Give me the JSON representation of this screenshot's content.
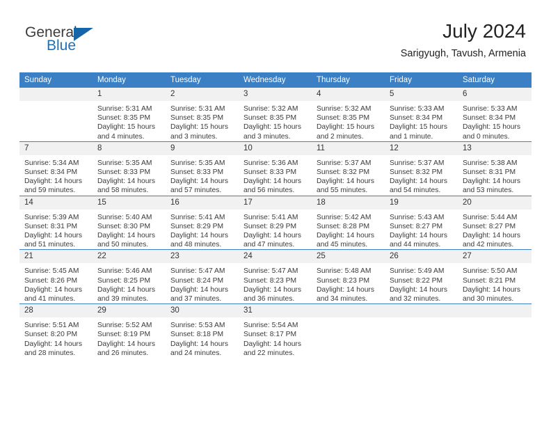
{
  "brand": {
    "name_part1": "General",
    "name_part2": "Blue",
    "logo_icon": "triangle-icon",
    "accent_color": "#1565a8"
  },
  "header": {
    "month_title": "July 2024",
    "location": "Sarigyugh, Tavush, Armenia"
  },
  "calendar": {
    "header_color": "#3b7fc4",
    "daynum_bg": "#f1f1f1",
    "weekday_headers": [
      "Sunday",
      "Monday",
      "Tuesday",
      "Wednesday",
      "Thursday",
      "Friday",
      "Saturday"
    ],
    "weeks": [
      [
        {
          "day": "",
          "lines": []
        },
        {
          "day": "1",
          "lines": [
            "Sunrise: 5:31 AM",
            "Sunset: 8:35 PM",
            "Daylight: 15 hours",
            "and 4 minutes."
          ]
        },
        {
          "day": "2",
          "lines": [
            "Sunrise: 5:31 AM",
            "Sunset: 8:35 PM",
            "Daylight: 15 hours",
            "and 3 minutes."
          ]
        },
        {
          "day": "3",
          "lines": [
            "Sunrise: 5:32 AM",
            "Sunset: 8:35 PM",
            "Daylight: 15 hours",
            "and 3 minutes."
          ]
        },
        {
          "day": "4",
          "lines": [
            "Sunrise: 5:32 AM",
            "Sunset: 8:35 PM",
            "Daylight: 15 hours",
            "and 2 minutes."
          ]
        },
        {
          "day": "5",
          "lines": [
            "Sunrise: 5:33 AM",
            "Sunset: 8:34 PM",
            "Daylight: 15 hours",
            "and 1 minute."
          ]
        },
        {
          "day": "6",
          "lines": [
            "Sunrise: 5:33 AM",
            "Sunset: 8:34 PM",
            "Daylight: 15 hours",
            "and 0 minutes."
          ]
        }
      ],
      [
        {
          "day": "7",
          "lines": [
            "Sunrise: 5:34 AM",
            "Sunset: 8:34 PM",
            "Daylight: 14 hours",
            "and 59 minutes."
          ]
        },
        {
          "day": "8",
          "lines": [
            "Sunrise: 5:35 AM",
            "Sunset: 8:33 PM",
            "Daylight: 14 hours",
            "and 58 minutes."
          ]
        },
        {
          "day": "9",
          "lines": [
            "Sunrise: 5:35 AM",
            "Sunset: 8:33 PM",
            "Daylight: 14 hours",
            "and 57 minutes."
          ]
        },
        {
          "day": "10",
          "lines": [
            "Sunrise: 5:36 AM",
            "Sunset: 8:33 PM",
            "Daylight: 14 hours",
            "and 56 minutes."
          ]
        },
        {
          "day": "11",
          "lines": [
            "Sunrise: 5:37 AM",
            "Sunset: 8:32 PM",
            "Daylight: 14 hours",
            "and 55 minutes."
          ]
        },
        {
          "day": "12",
          "lines": [
            "Sunrise: 5:37 AM",
            "Sunset: 8:32 PM",
            "Daylight: 14 hours",
            "and 54 minutes."
          ]
        },
        {
          "day": "13",
          "lines": [
            "Sunrise: 5:38 AM",
            "Sunset: 8:31 PM",
            "Daylight: 14 hours",
            "and 53 minutes."
          ]
        }
      ],
      [
        {
          "day": "14",
          "lines": [
            "Sunrise: 5:39 AM",
            "Sunset: 8:31 PM",
            "Daylight: 14 hours",
            "and 51 minutes."
          ]
        },
        {
          "day": "15",
          "lines": [
            "Sunrise: 5:40 AM",
            "Sunset: 8:30 PM",
            "Daylight: 14 hours",
            "and 50 minutes."
          ]
        },
        {
          "day": "16",
          "lines": [
            "Sunrise: 5:41 AM",
            "Sunset: 8:29 PM",
            "Daylight: 14 hours",
            "and 48 minutes."
          ]
        },
        {
          "day": "17",
          "lines": [
            "Sunrise: 5:41 AM",
            "Sunset: 8:29 PM",
            "Daylight: 14 hours",
            "and 47 minutes."
          ]
        },
        {
          "day": "18",
          "lines": [
            "Sunrise: 5:42 AM",
            "Sunset: 8:28 PM",
            "Daylight: 14 hours",
            "and 45 minutes."
          ]
        },
        {
          "day": "19",
          "lines": [
            "Sunrise: 5:43 AM",
            "Sunset: 8:27 PM",
            "Daylight: 14 hours",
            "and 44 minutes."
          ]
        },
        {
          "day": "20",
          "lines": [
            "Sunrise: 5:44 AM",
            "Sunset: 8:27 PM",
            "Daylight: 14 hours",
            "and 42 minutes."
          ]
        }
      ],
      [
        {
          "day": "21",
          "lines": [
            "Sunrise: 5:45 AM",
            "Sunset: 8:26 PM",
            "Daylight: 14 hours",
            "and 41 minutes."
          ]
        },
        {
          "day": "22",
          "lines": [
            "Sunrise: 5:46 AM",
            "Sunset: 8:25 PM",
            "Daylight: 14 hours",
            "and 39 minutes."
          ]
        },
        {
          "day": "23",
          "lines": [
            "Sunrise: 5:47 AM",
            "Sunset: 8:24 PM",
            "Daylight: 14 hours",
            "and 37 minutes."
          ]
        },
        {
          "day": "24",
          "lines": [
            "Sunrise: 5:47 AM",
            "Sunset: 8:23 PM",
            "Daylight: 14 hours",
            "and 36 minutes."
          ]
        },
        {
          "day": "25",
          "lines": [
            "Sunrise: 5:48 AM",
            "Sunset: 8:23 PM",
            "Daylight: 14 hours",
            "and 34 minutes."
          ]
        },
        {
          "day": "26",
          "lines": [
            "Sunrise: 5:49 AM",
            "Sunset: 8:22 PM",
            "Daylight: 14 hours",
            "and 32 minutes."
          ]
        },
        {
          "day": "27",
          "lines": [
            "Sunrise: 5:50 AM",
            "Sunset: 8:21 PM",
            "Daylight: 14 hours",
            "and 30 minutes."
          ]
        }
      ],
      [
        {
          "day": "28",
          "lines": [
            "Sunrise: 5:51 AM",
            "Sunset: 8:20 PM",
            "Daylight: 14 hours",
            "and 28 minutes."
          ]
        },
        {
          "day": "29",
          "lines": [
            "Sunrise: 5:52 AM",
            "Sunset: 8:19 PM",
            "Daylight: 14 hours",
            "and 26 minutes."
          ]
        },
        {
          "day": "30",
          "lines": [
            "Sunrise: 5:53 AM",
            "Sunset: 8:18 PM",
            "Daylight: 14 hours",
            "and 24 minutes."
          ]
        },
        {
          "day": "31",
          "lines": [
            "Sunrise: 5:54 AM",
            "Sunset: 8:17 PM",
            "Daylight: 14 hours",
            "and 22 minutes."
          ]
        },
        {
          "day": "",
          "lines": []
        },
        {
          "day": "",
          "lines": []
        },
        {
          "day": "",
          "lines": []
        }
      ]
    ]
  }
}
